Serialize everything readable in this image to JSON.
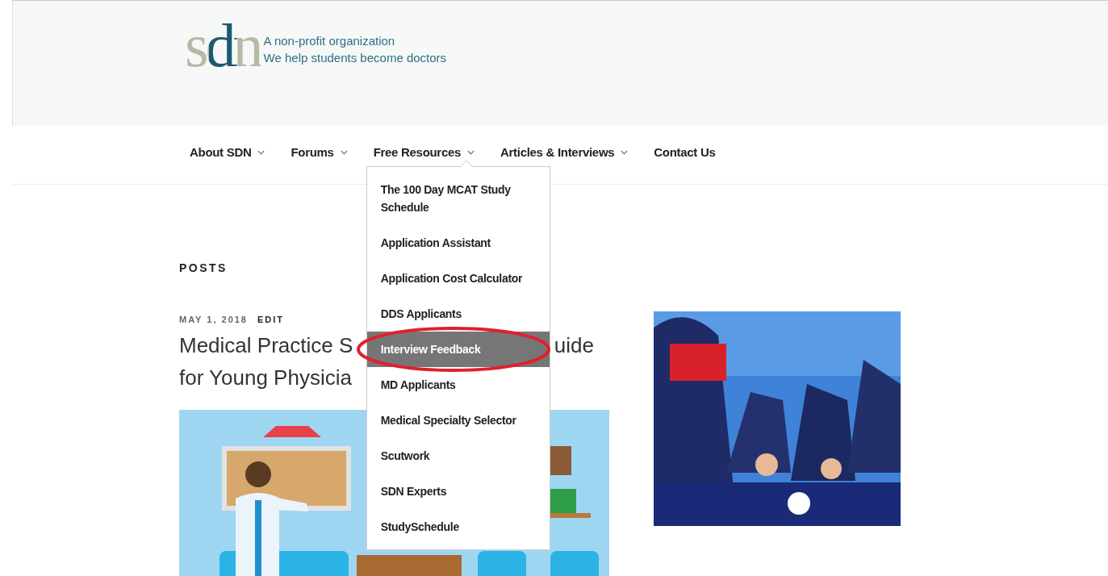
{
  "header": {
    "logo": "sdn",
    "tagline_lines": [
      "A non-profit organization",
      "We help students become doctors"
    ]
  },
  "nav": [
    {
      "label": "About SDN",
      "has_submenu": true
    },
    {
      "label": "Forums",
      "has_submenu": true
    },
    {
      "label": "Free Resources",
      "has_submenu": true,
      "submenu": [
        {
          "label": "The 100 Day MCAT Study Schedule",
          "selected": false
        },
        {
          "label": "Application Assistant",
          "selected": false
        },
        {
          "label": "Application Cost Calculator",
          "selected": false
        },
        {
          "label": "DDS Applicants",
          "selected": false
        },
        {
          "label": "Interview Feedback",
          "selected": true
        },
        {
          "label": "MD Applicants",
          "selected": false
        },
        {
          "label": "Medical Specialty Selector",
          "selected": false
        },
        {
          "label": "Scutwork",
          "selected": false
        },
        {
          "label": "SDN Experts",
          "selected": false
        },
        {
          "label": "StudySchedule",
          "selected": false
        }
      ]
    },
    {
      "label": "Articles & Interviews",
      "has_submenu": true
    },
    {
      "label": "Contact Us",
      "has_submenu": false
    }
  ],
  "posts": {
    "heading": "POSTS",
    "post": {
      "date": "MAY 1, 2018",
      "edit": "EDIT",
      "title_visible": [
        [
          "Medical Practice S",
          "uide"
        ],
        [
          "for Young Physicia"
        ]
      ],
      "image": {
        "kind": "picture"
      }
    }
  },
  "ad": {
    "kind": "picture"
  }
}
